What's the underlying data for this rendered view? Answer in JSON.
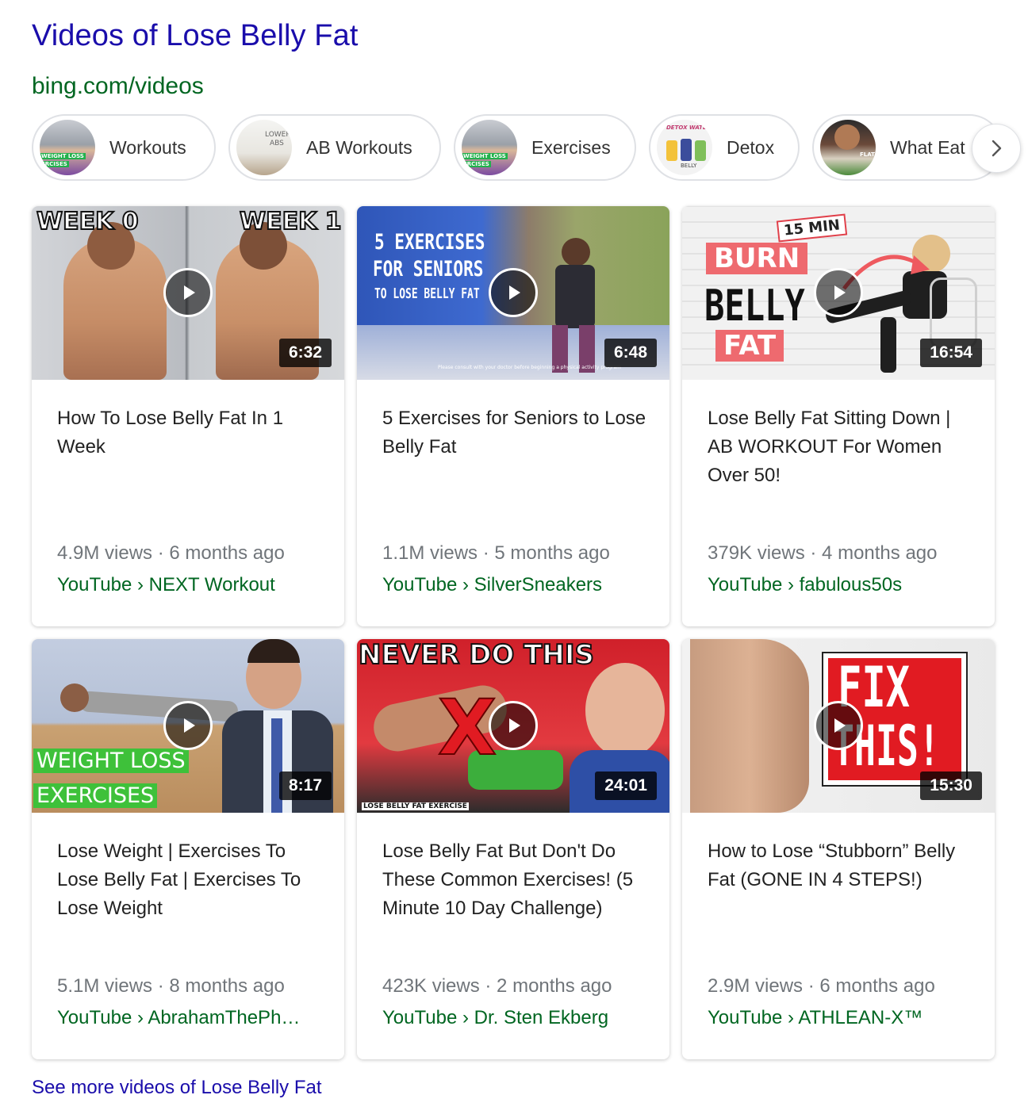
{
  "header": {
    "title": "Videos of Lose Belly Fat",
    "url": "bing.com/videos"
  },
  "chips": [
    {
      "label": "Workouts",
      "thumb_text": [
        "WEIGHT LOSS",
        "ERCISES"
      ]
    },
    {
      "label": "AB Workouts",
      "thumb_text": [
        "LOWER",
        "ABS"
      ]
    },
    {
      "label": "Exercises",
      "thumb_text": [
        "WEIGHT LOSS",
        "ERCISES"
      ]
    },
    {
      "label": "Detox",
      "thumb_text": [
        "DETOX WATER",
        "BELLY"
      ]
    },
    {
      "label": "What Eat",
      "thumb_text": [
        "FLAT"
      ]
    }
  ],
  "chip_next_icon": "chevron-right-icon",
  "videos": [
    {
      "title": "How To Lose Belly Fat In 1 Week",
      "duration": "6:32",
      "meta": "4.9M views · 6 months ago",
      "source": "YouTube › NEXT Workout",
      "overlay": [
        "WEEK 0",
        "WEEK 1"
      ]
    },
    {
      "title": "5 Exercises for Seniors to Lose Belly Fat",
      "duration": "6:48",
      "meta": "1.1M views · 5 months ago",
      "source": "YouTube › SilverSneakers",
      "overlay": [
        "5 EXERCISES",
        "FOR SENIORS",
        "TO LOSE BELLY FAT",
        "Please consult with your doctor before beginning a physical activity program"
      ]
    },
    {
      "title": "Lose Belly Fat Sitting Down | AB WORKOUT For Women Over 50!",
      "duration": "16:54",
      "meta": "379K views · 4 months ago",
      "source": "YouTube › fabulous50s",
      "overlay": [
        "15 MIN",
        "BURN",
        "BELLY",
        "FAT"
      ]
    },
    {
      "title": "Lose Weight | Exercises To Lose Belly Fat | Exercises To Lose Weight",
      "duration": "8:17",
      "meta": "5.1M views · 8 months ago",
      "source": "YouTube › AbrahamThePh…",
      "overlay": [
        "WEIGHT LOSS",
        "EXERCISES"
      ]
    },
    {
      "title": "Lose Belly Fat But Don't Do These Common Exercises! (5 Minute 10 Day Challenge)",
      "duration": "24:01",
      "meta": "423K views · 2 months ago",
      "source": "YouTube › Dr. Sten Ekberg",
      "overlay": [
        "NEVER DO THIS",
        "X",
        "LOSE BELLY FAT EXERCISE"
      ]
    },
    {
      "title": "How to Lose “Stubborn” Belly Fat (GONE IN 4 STEPS!)",
      "duration": "15:30",
      "meta": "2.9M views · 6 months ago",
      "source": "YouTube › ATHLEAN-X™",
      "overlay": [
        "FIX",
        "THIS!"
      ]
    }
  ],
  "see_more": "See more videos of Lose Belly Fat",
  "colors": {
    "link": "#1a0dab",
    "url_green": "#006621",
    "meta_gray": "#70757a"
  }
}
